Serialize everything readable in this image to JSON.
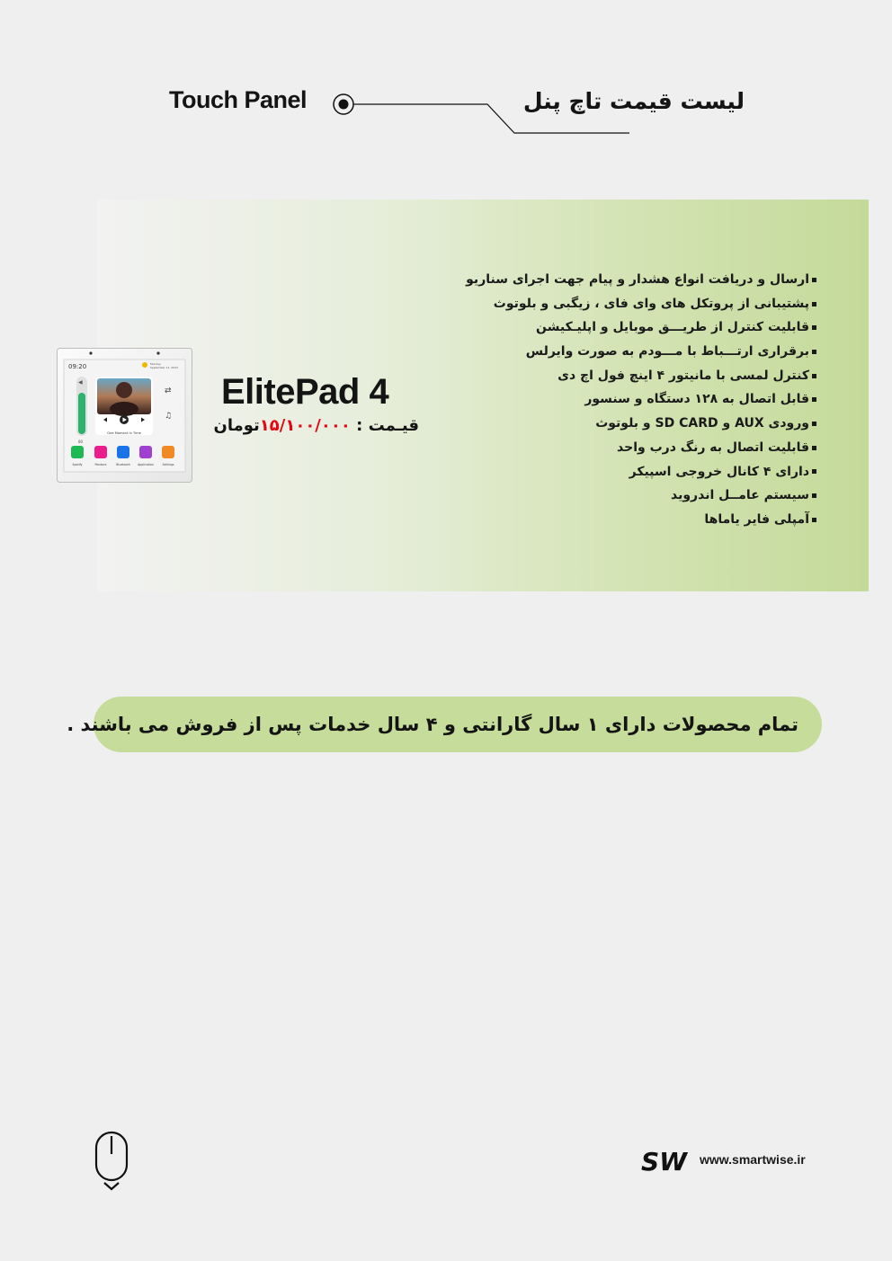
{
  "header": {
    "title_en": "Touch Panel",
    "title_fa": "لیست قیمت تاچ پنل"
  },
  "product": {
    "name": "ElitePad 4",
    "price_label": "قیـمت :",
    "price_value": "۱۵/۱۰۰/۰۰۰",
    "price_currency": "تومان",
    "image": {
      "time": "09:20",
      "date_lines": [
        "Monday",
        "September 11, 2023"
      ],
      "volume": "80",
      "track": "One Moment In Time",
      "apps": [
        {
          "name": "Spotify",
          "color": "#1db954"
        },
        {
          "name": "Pandora",
          "color": "#e91e8c"
        },
        {
          "name": "Bluetooth",
          "color": "#1a73e8"
        },
        {
          "name": "Application",
          "color": "#a040d0"
        },
        {
          "name": "Settings",
          "color": "#f08a24"
        }
      ]
    },
    "features": [
      "ارسال و دریافت انواع هشدار و پیام جهت اجرای سناریو",
      "پشتیبانی از پروتکل های وای فای ، زیگبی و بلوتوث",
      "قابلیت کنترل از طریـــق موبایل و اپلیـکیشن",
      "برقراری ارتـــباط با مـــودم به صورت وایرلس",
      "کنترل لمسی با مانیتور ۴ اینچ فول اچ دی",
      "قابل اتصال به ۱۲۸ دستگاه و سنسور",
      "ورودی AUX و SD CARD و بلوتوث",
      "قابلیت اتصال به رنگ درب واحد",
      "دارای ۴ کانال خروجی اسپیکر",
      "سیستم عامــل اندروید",
      "آمپلی فایر یاماها"
    ]
  },
  "guarantee_text": "تمام محصولات دارای ۱ سال گارانتی و ۴ سال خدمات پس از فروش می باشند .",
  "footer": {
    "logo_text": "SW",
    "website": "www.smartwise.ir"
  },
  "colors": {
    "band_start": "#f2f2f2",
    "band_end": "#c4da9a",
    "pill": "#c6dc9a",
    "price": "#e30613"
  }
}
